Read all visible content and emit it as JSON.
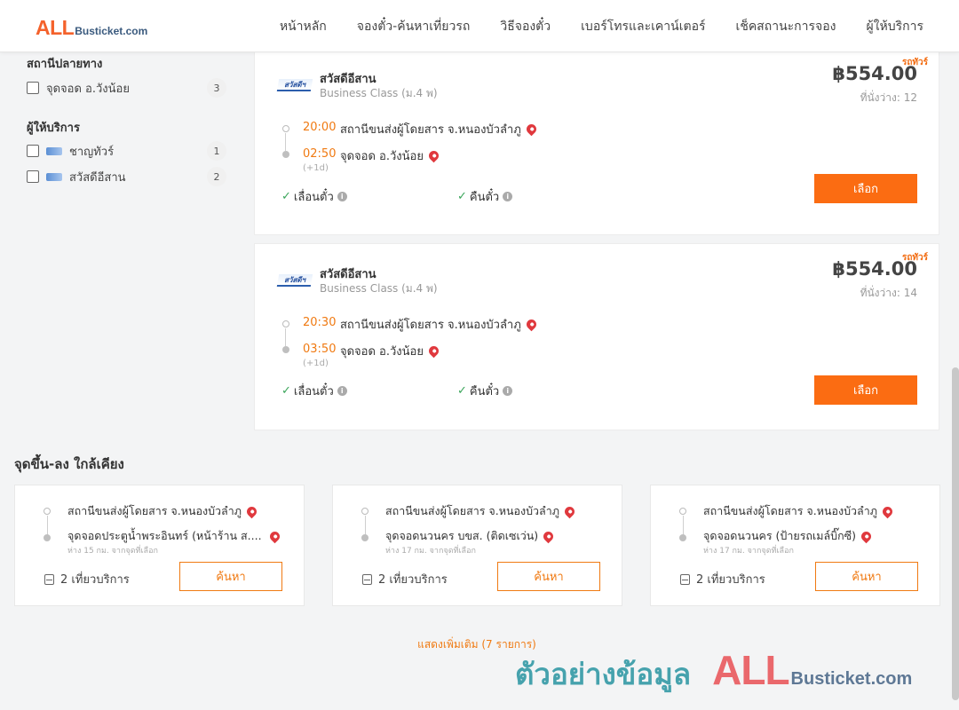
{
  "header": {
    "logo": {
      "all": "ALL",
      "rest": "Busticket.com"
    },
    "nav": [
      "หน้าหลัก",
      "จองตั๋ว-ค้นหาเที่ยวรถ",
      "วิธีจองตั๋ว",
      "เบอร์โทรและเคาน์เตอร์",
      "เช็คสถานะการจอง",
      "ผู้ให้บริการ"
    ]
  },
  "sidebar": {
    "destination": {
      "title": "สถานีปลายทาง",
      "items": [
        {
          "label": "จุดจอด อ.วังน้อย",
          "count": "3"
        }
      ]
    },
    "operators": {
      "title": "ผู้ให้บริการ",
      "items": [
        {
          "label": "ชาญทัวร์",
          "count": "1"
        },
        {
          "label": "สวัสดีอีสาน",
          "count": "2"
        }
      ]
    }
  },
  "trips": [
    {
      "tag": "รถทัวร์",
      "logo_text": "สวัสดีฯ",
      "operator": "สวัสดีอีสาน",
      "class": "Business Class (ม.4 พ)",
      "price": "฿554.00",
      "seats": "ที่นั่งว่าง: 12",
      "depart_time": "20:00",
      "depart_stop": "สถานีขนส่งผู้โดยสาร จ.หนองบัวลำภู",
      "arrive_time": "02:50",
      "arrive_stop": "จุดจอด อ.วังน้อย",
      "plus_day": "(+1d)",
      "feature1": "เลื่อนตั๋ว",
      "feature2": "คืนตั๋ว",
      "button": "เลือก"
    },
    {
      "tag": "รถทัวร์",
      "logo_text": "สวัสดีฯ",
      "operator": "สวัสดีอีสาน",
      "class": "Business Class (ม.4 พ)",
      "price": "฿554.00",
      "seats": "ที่นั่งว่าง: 14",
      "depart_time": "20:30",
      "depart_stop": "สถานีขนส่งผู้โดยสาร จ.หนองบัวลำภู",
      "arrive_time": "03:50",
      "arrive_stop": "จุดจอด อ.วังน้อย",
      "plus_day": "(+1d)",
      "feature1": "เลื่อนตั๋ว",
      "feature2": "คืนตั๋ว",
      "button": "เลือก"
    }
  ],
  "nearby": {
    "title": "จุดขึ้น-ลง ใกล้เคียง",
    "cards": [
      {
        "from": "สถานีขนส่งผู้โดยสาร จ.หนองบัวลำภู",
        "to": "จุดจอดประตูน้ำพระอินทร์ (หน้าร้าน ส....",
        "distance": "ห่าง 15 กม. จากจุดที่เลือก",
        "trips": "2 เที่ยวบริการ",
        "button": "ค้นหา"
      },
      {
        "from": "สถานีขนส่งผู้โดยสาร จ.หนองบัวลำภู",
        "to": "จุดจอดนวนคร บขส. (ติดเซเว่น)",
        "distance": "ห่าง 17 กม. จากจุดที่เลือก",
        "trips": "2 เที่ยวบริการ",
        "button": "ค้นหา"
      },
      {
        "from": "สถานีขนส่งผู้โดยสาร จ.หนองบัวลำภู",
        "to": "จุดจอดนวนคร (ป้ายรถเมล์บิ๊กซี)",
        "distance": "ห่าง 17 กม. จากจุดที่เลือก",
        "trips": "2 เที่ยวบริการ",
        "button": "ค้นหา"
      }
    ]
  },
  "show_more": "แสดงเพิ่มเติม (7 รายการ)",
  "watermark": {
    "text": "ตัวอย่างข้อมูล",
    "all": "ALL",
    "rest": "Busticket.com"
  },
  "colors": {
    "accent": "#fb6c12",
    "time": "#f07a12",
    "check": "#3aa55a",
    "pin": "#e0393e"
  }
}
